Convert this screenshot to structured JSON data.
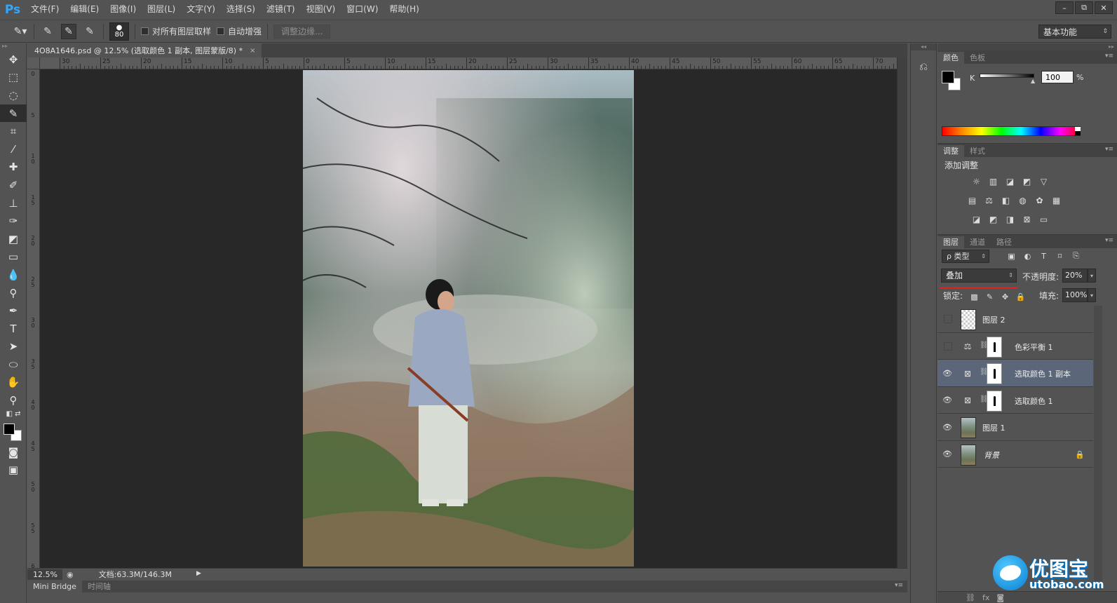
{
  "app": {
    "logo": "Ps"
  },
  "menu": [
    "文件(F)",
    "编辑(E)",
    "图像(I)",
    "图层(L)",
    "文字(Y)",
    "选择(S)",
    "滤镜(T)",
    "视图(V)",
    "窗口(W)",
    "帮助(H)"
  ],
  "window_controls": {
    "minimize": "–",
    "restore": "⧉",
    "close": "✕"
  },
  "options": {
    "brush_size": "80",
    "sample_all_layers": "对所有图层取样",
    "auto_enhance": "自动增强",
    "refine_edge": "调整边缘...",
    "workspace": "基本功能"
  },
  "document": {
    "tab_title": "4O8A1646.psd @ 12.5% (选取颜色 1 副本, 图层蒙版/8) *",
    "close_glyph": "×",
    "zoom": "12.5%",
    "doc_info": "文档:63.3M/146.3M"
  },
  "ruler": {
    "top": [
      "30",
      "25",
      "20",
      "15",
      "10",
      "5",
      "0",
      "5",
      "10",
      "15",
      "20",
      "25",
      "30",
      "35",
      "40",
      "45",
      "50",
      "55",
      "60",
      "65",
      "70"
    ],
    "left": [
      "0",
      "5",
      "1\n0",
      "1\n5",
      "2\n0",
      "2\n5",
      "3\n0",
      "3\n5",
      "4\n0",
      "4\n5",
      "5\n0",
      "5\n5",
      "6"
    ]
  },
  "bottom_tabs": [
    "Mini Bridge",
    "时间轴"
  ],
  "panels": {
    "color": {
      "tabs": [
        "颜色",
        "色板"
      ],
      "channel": "K",
      "value": "100",
      "unit": "%",
      "foreground": "#000000",
      "background": "#ffffff"
    },
    "adjustments": {
      "tabs": [
        "调整",
        "样式"
      ],
      "title": "添加调整"
    },
    "layers": {
      "tabs": [
        "图层",
        "通道",
        "路径"
      ],
      "filter_kind": "ρ 类型",
      "blend_mode": "叠加",
      "opacity_label": "不透明度:",
      "opacity": "20%",
      "lock_label": "锁定:",
      "fill_label": "填充:",
      "fill": "100%",
      "items": [
        {
          "name": "图层 2",
          "visible": false,
          "type": "pixel",
          "selected": false
        },
        {
          "name": "色彩平衡 1",
          "visible": false,
          "type": "adjustment",
          "selected": false
        },
        {
          "name": "选取颜色 1 副本",
          "visible": true,
          "type": "adjustment",
          "selected": true
        },
        {
          "name": "选取颜色 1",
          "visible": true,
          "type": "adjustment",
          "selected": false
        },
        {
          "name": "图层 1",
          "visible": true,
          "type": "photo",
          "selected": false
        },
        {
          "name": "背景",
          "visible": true,
          "type": "background",
          "selected": false
        }
      ]
    }
  },
  "watermark": {
    "cn": "优图宝",
    "en": "utobao.com"
  },
  "colors": {
    "accent_red": "#e02020",
    "selection_blue": "#5b6779",
    "ps_blue": "#31a8ff"
  }
}
